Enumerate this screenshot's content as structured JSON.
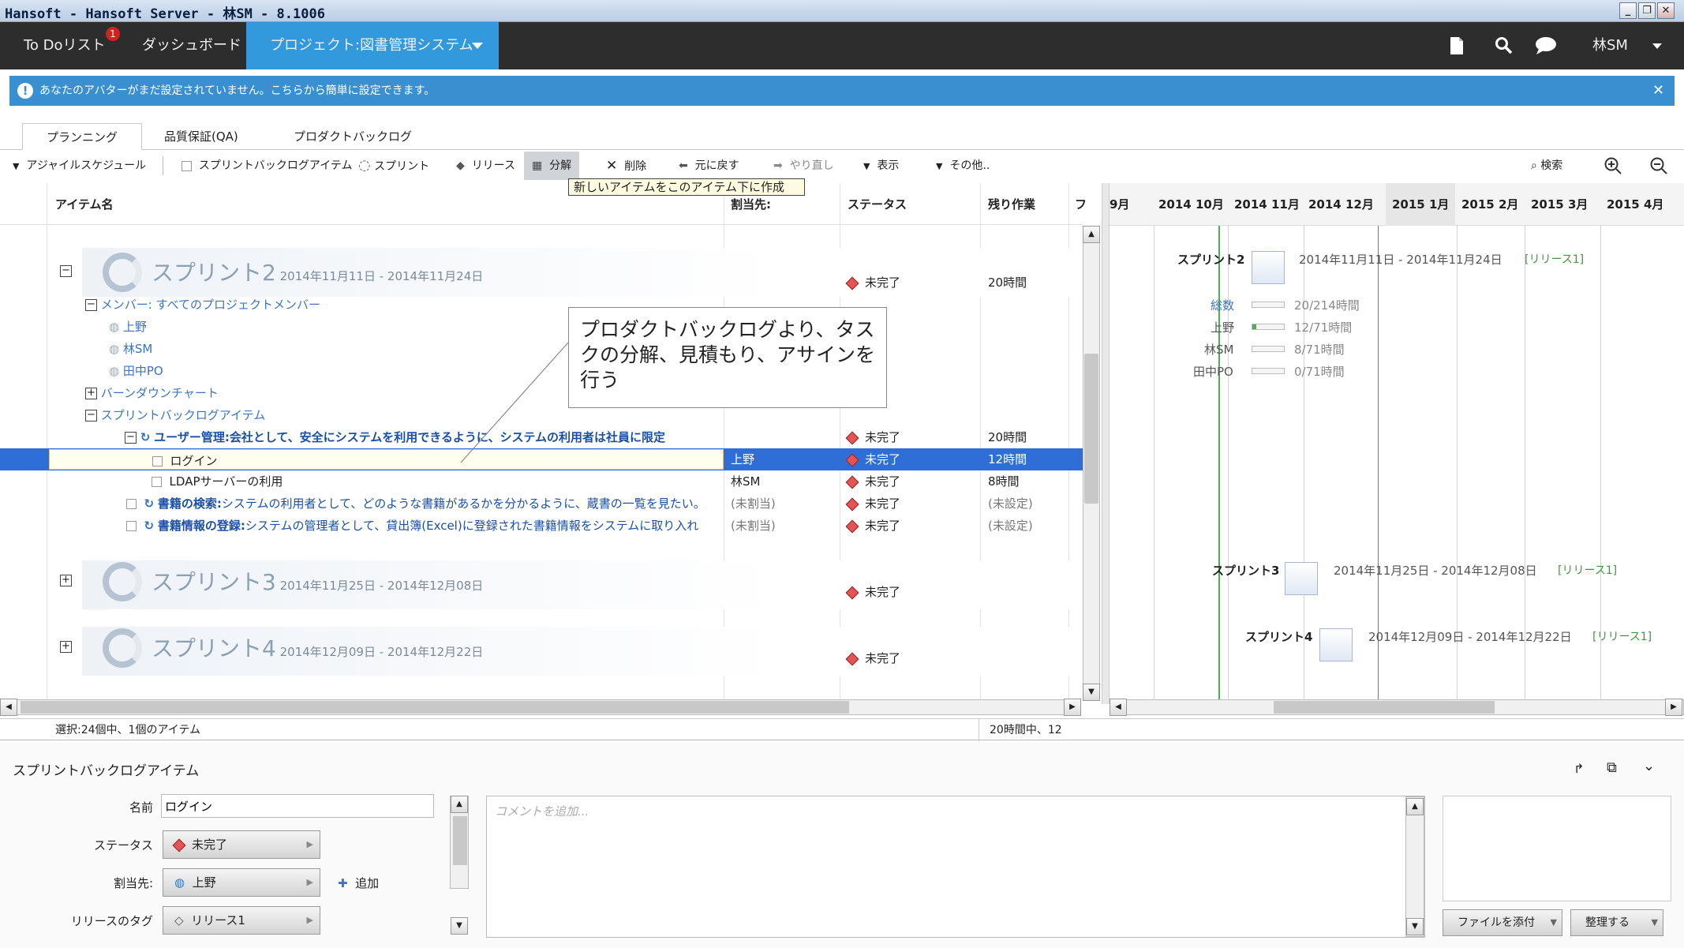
{
  "window": {
    "title": "Hansoft - Hansoft Server - 林SM - 8.1006",
    "min": "_",
    "max": "❐",
    "close": "✕"
  },
  "menubar": {
    "todo": "To Doリスト",
    "todo_badge": "1",
    "dashboard": "ダッシュボード",
    "project": "プロジェクト:図書管理システム",
    "user": "林SM"
  },
  "notice": {
    "text": "あなたのアバターがまだ設定されていません。こちらから簡単に設定できます。"
  },
  "tabs": [
    "プランニング",
    "品質保証(QA)",
    "プロダクトバックログ"
  ],
  "toolbar": {
    "agile": "アジャイルスケジュール",
    "sprint_item": "スプリントバックログアイテム",
    "sprint": "スプリント",
    "release": "リリース",
    "breakdown": "分解",
    "delete": "削除",
    "undo": "元に戻す",
    "redo": "やり直し",
    "view": "表示",
    "more": "その他..",
    "search": "検索",
    "tooltip": "新しいアイテムをこのアイテム下に作成"
  },
  "grid": {
    "headers": {
      "name": "アイテム名",
      "assign": "割当先:",
      "status": "ステータス",
      "remain": "残り作業",
      "f": "フ"
    },
    "sprint2": {
      "name": "スプリント2",
      "dates": "2014年11月11日 - 2014年11月24日",
      "status": "未完了",
      "remain": "20時間"
    },
    "members": "メンバー: すべてのプロジェクトメンバー",
    "member_list": [
      "上野",
      "林SM",
      "田中PO"
    ],
    "burndown": "バーンダウンチャート",
    "backlog": "スプリントバックログアイテム",
    "story1": {
      "title": "ユーザー管理:",
      "desc": "会社として、安全にシステムを利用できるように、システムの利用者は社員に限定",
      "status": "未完了",
      "remain": "20時間"
    },
    "task1": {
      "name": "ログイン",
      "assign": "上野",
      "status": "未完了",
      "remain": "12時間"
    },
    "task2": {
      "name": "LDAPサーバーの利用",
      "assign": "林SM",
      "status": "未完了",
      "remain": "8時間"
    },
    "story2": {
      "title": "書籍の検索:",
      "desc": "システムの利用者として、どのような書籍があるかを分かるように、蔵書の一覧を見たい。",
      "assign": "(未割当)",
      "status": "未完了",
      "remain": "(未設定)"
    },
    "story3": {
      "title": "書籍情報の登録:",
      "desc": "システムの管理者として、貸出簿(Excel)に登録された書籍情報をシステムに取り入れ",
      "assign": "(未割当)",
      "status": "未完了",
      "remain": "(未設定)"
    },
    "sprint3": {
      "name": "スプリント3",
      "dates": "2014年11月25日 - 2014年12月08日",
      "status": "未完了"
    },
    "sprint4": {
      "name": "スプリント4",
      "dates": "2014年12月09日 - 2014年12月22日",
      "status": "未完了"
    }
  },
  "gantt": {
    "months": [
      "9月",
      "2014 10月",
      "2014 11月",
      "2014 12月",
      "2015 1月",
      "2015 2月",
      "2015 3月",
      "2015 4月"
    ],
    "s2": {
      "name": "スプリント2",
      "dates": "2014年11月11日 - 2014年11月24日",
      "tag": "[リリース1]"
    },
    "total": {
      "label": "総数",
      "value": "20/214時間"
    },
    "m1": {
      "label": "上野",
      "value": "12/71時間"
    },
    "m2": {
      "label": "林SM",
      "value": "8/71時間"
    },
    "m3": {
      "label": "田中PO",
      "value": "0/71時間"
    },
    "s3": {
      "name": "スプリント3",
      "dates": "2014年11月25日 - 2014年12月08日",
      "tag": "[リリース1]"
    },
    "s4": {
      "name": "スプリント4",
      "dates": "2014年12月09日 - 2014年12月22日",
      "tag": "[リリース1]"
    }
  },
  "callout": "プロダクトバックログより、タスクの分解、見積もり、アサインを行う",
  "status": {
    "left": "選択:24個中、1個のアイテム",
    "right": "20時間中、12"
  },
  "detail": {
    "title": "スプリントバックログアイテム",
    "name_label": "名前",
    "name_value": "ログイン",
    "status_label": "ステータス",
    "status_value": "未完了",
    "assign_label": "割当先:",
    "assign_value": "上野",
    "add": "追加",
    "release_label": "リリースのタグ",
    "release_value": "リリース1",
    "comment_placeholder": "コメントを追加...",
    "attach": "ファイルを添付",
    "organize": "整理する"
  },
  "colors": {
    "accent": "#3399dd",
    "selected": "#2e6ed6",
    "status_red": "#e25555"
  }
}
